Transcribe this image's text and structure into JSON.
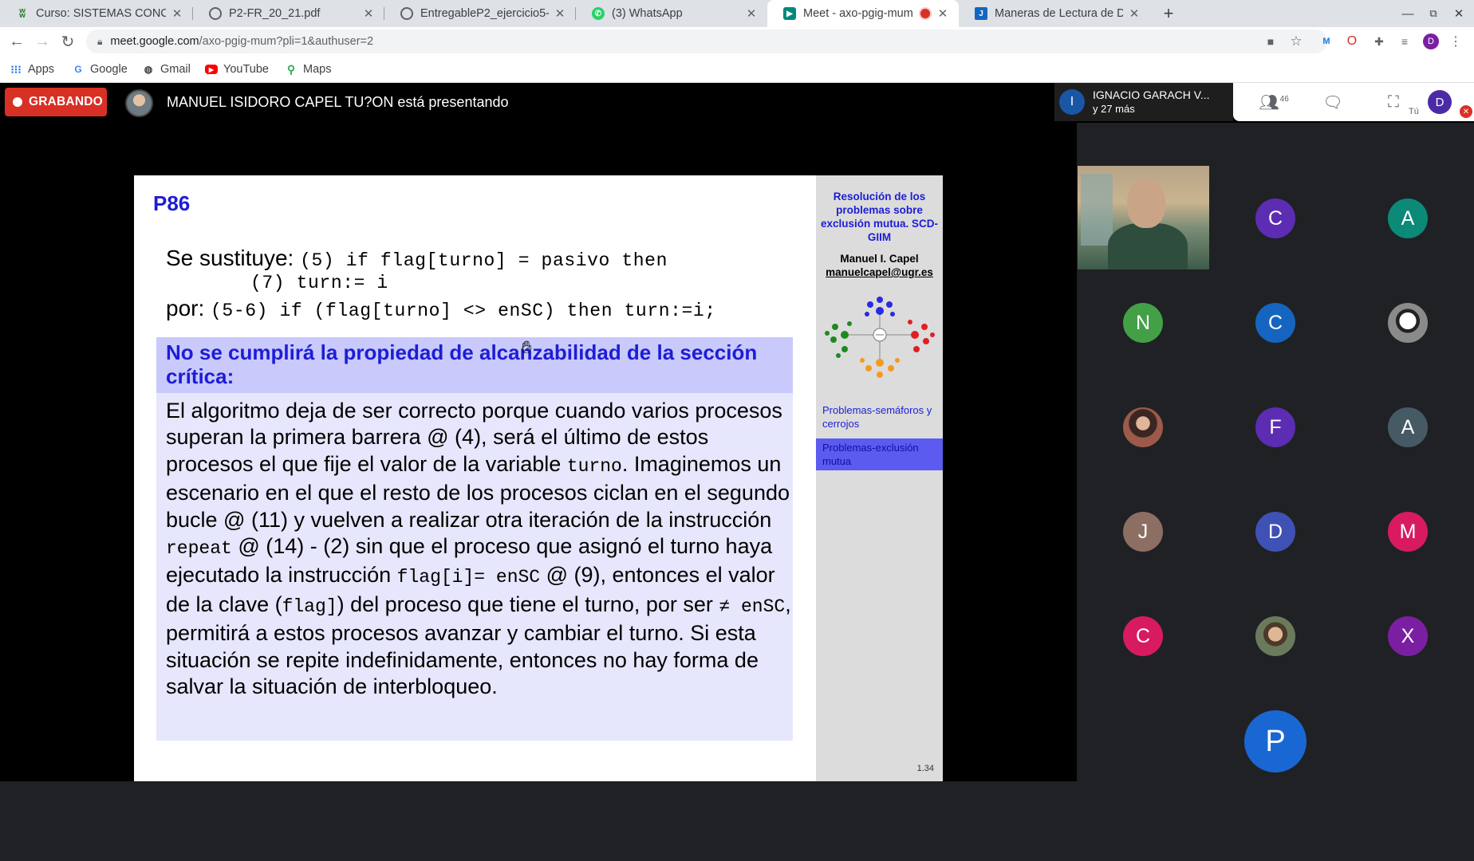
{
  "tabs": [
    {
      "title": "Curso: SISTEMAS CONCUR",
      "favicon": "moodle-icon",
      "color": "#2e7d32"
    },
    {
      "title": "P2-FR_20_21.pdf",
      "favicon": "globe-icon",
      "color": "#5f6368"
    },
    {
      "title": "EntregableP2_ejercicio5-",
      "favicon": "globe-icon",
      "color": "#5f6368"
    },
    {
      "title": "(3) WhatsApp",
      "favicon": "whatsapp-icon",
      "color": "#25d366"
    },
    {
      "title": "Meet - axo-pgig-mum",
      "favicon": "meet-icon",
      "color": "#00897b"
    },
    {
      "title": "Maneras de Lectura de Da",
      "favicon": "j-icon",
      "color": "#1565c0"
    }
  ],
  "omnibox": {
    "host": "meet.google.com",
    "path": "/axo-pgig-mum?pli=1&authuser=2"
  },
  "bookmarks": [
    {
      "label": "Apps",
      "icon": "apps-grid-icon"
    },
    {
      "label": "Google",
      "icon": "google-icon"
    },
    {
      "label": "Gmail",
      "icon": "gmail-icon"
    },
    {
      "label": "YouTube",
      "icon": "youtube-icon"
    },
    {
      "label": "Maps",
      "icon": "maps-icon"
    }
  ],
  "profile_initial": "D",
  "meet": {
    "recording_label": "GRABANDO",
    "presenting_text": "MANUEL ISIDORO CAPEL TU?ON está presentando",
    "attendee_initial": "I",
    "attendee_name": "IGNACIO GARACH V...",
    "attendee_more": "y 27 más",
    "people_count": "46",
    "you_label": "Tú",
    "you_initial": "D"
  },
  "slide": {
    "number": "P86",
    "line1_label": "Se sustituye:",
    "line1_code": "(5) if flag[turno] = pasivo then",
    "line2_code": "(7) turn:= i",
    "line3_label": "por:",
    "line3_code": "(5-6) if (flag[turno] <> enSC) then turn:=i;",
    "heading": "No se cumplirá la propiedad de alcanzabilidad de la sección crítica:",
    "body": [
      "El algoritmo deja de ser correcto porque cuando varios procesos superan la primera barrera @ (4), será el último de estos procesos el que fije el valor de la variable ",
      "turno",
      ". Imaginemos un escenario en el que el resto de los procesos ciclan en el segundo bucle @ (11) y vuelven a realizar otra iteración de la instrucción ",
      "repeat",
      " @ (14) - (2) sin que el proceso que asignó el turno haya ejecutado la instrucción ",
      "flag[i]= enSC",
      " @ (9), entonces el valor de la clave (",
      "flag]",
      ") del proceso que tiene el turno, por ser ",
      "≠ enSC",
      ", permitirá a estos procesos avanzar y cambiar el turno. Si esta situación se repite indefinidamente, entonces no hay forma de salvar la situación de interbloqueo."
    ],
    "sidebar": {
      "title": "Resolución de los problemas sobre exclusión mutua. SCD-GIIM",
      "author": "Manuel I. Capel",
      "email": "manuelcapel@ugr.es",
      "link1": "Problemas-semáforos y cerrojos",
      "link2": "Problemas-exclusión mutua",
      "page": "1.34"
    }
  },
  "participants": [
    {
      "initial": "C",
      "color": "#5c2db3"
    },
    {
      "initial": "A",
      "color": "#0b8a77"
    },
    {
      "initial": "N",
      "color": "#43a047"
    },
    {
      "initial": "C",
      "color": "#1565c0"
    },
    {
      "initial": "",
      "color": "#707070",
      "photo": "skull-avatar-icon"
    },
    {
      "initial": "",
      "color": "#7a4e3b",
      "photo": "person-photo-icon"
    },
    {
      "initial": "F",
      "color": "#5c2db3"
    },
    {
      "initial": "A",
      "color": "#455a64"
    },
    {
      "initial": "J",
      "color": "#8d6e63"
    },
    {
      "initial": "D",
      "color": "#3f51b5"
    },
    {
      "initial": "M",
      "color": "#d81b60"
    },
    {
      "initial": "C",
      "color": "#d81b60"
    },
    {
      "initial": "",
      "color": "#6b7a5c",
      "photo": "person-photo-icon"
    },
    {
      "initial": "X",
      "color": "#7b1fa2"
    }
  ],
  "last_participant": {
    "initial": "P",
    "color": "#1967d2"
  }
}
